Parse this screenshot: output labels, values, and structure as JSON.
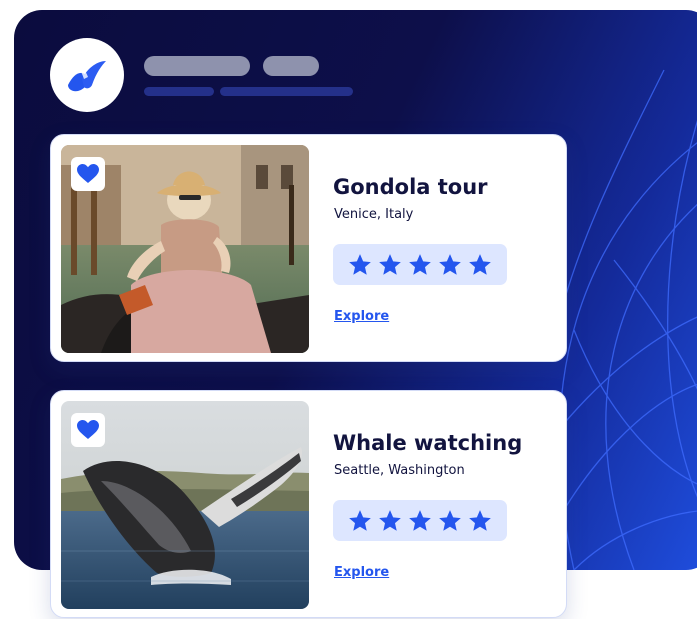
{
  "colors": {
    "panel_dark": "#0b0c3e",
    "panel_blue": "#1f4fe0",
    "brand_blue": "#2456ee",
    "rating_bg": "#dde6ff",
    "text_dark": "#12143f"
  },
  "header": {
    "logo_icon": "brand-swoosh-icon"
  },
  "cards": [
    {
      "title": "Gondola tour",
      "location": "Venice, Italy",
      "rating": 5,
      "rating_max": 5,
      "link_label": "Explore",
      "favorite_icon": "heart-icon",
      "image": "woman in sun hat riding gondola on canal"
    },
    {
      "title": "Whale watching",
      "location": "Seattle, Washington",
      "rating": 5,
      "rating_max": 5,
      "link_label": "Explore",
      "favorite_icon": "heart-icon",
      "image": "humpback whale breaching from the sea"
    }
  ]
}
